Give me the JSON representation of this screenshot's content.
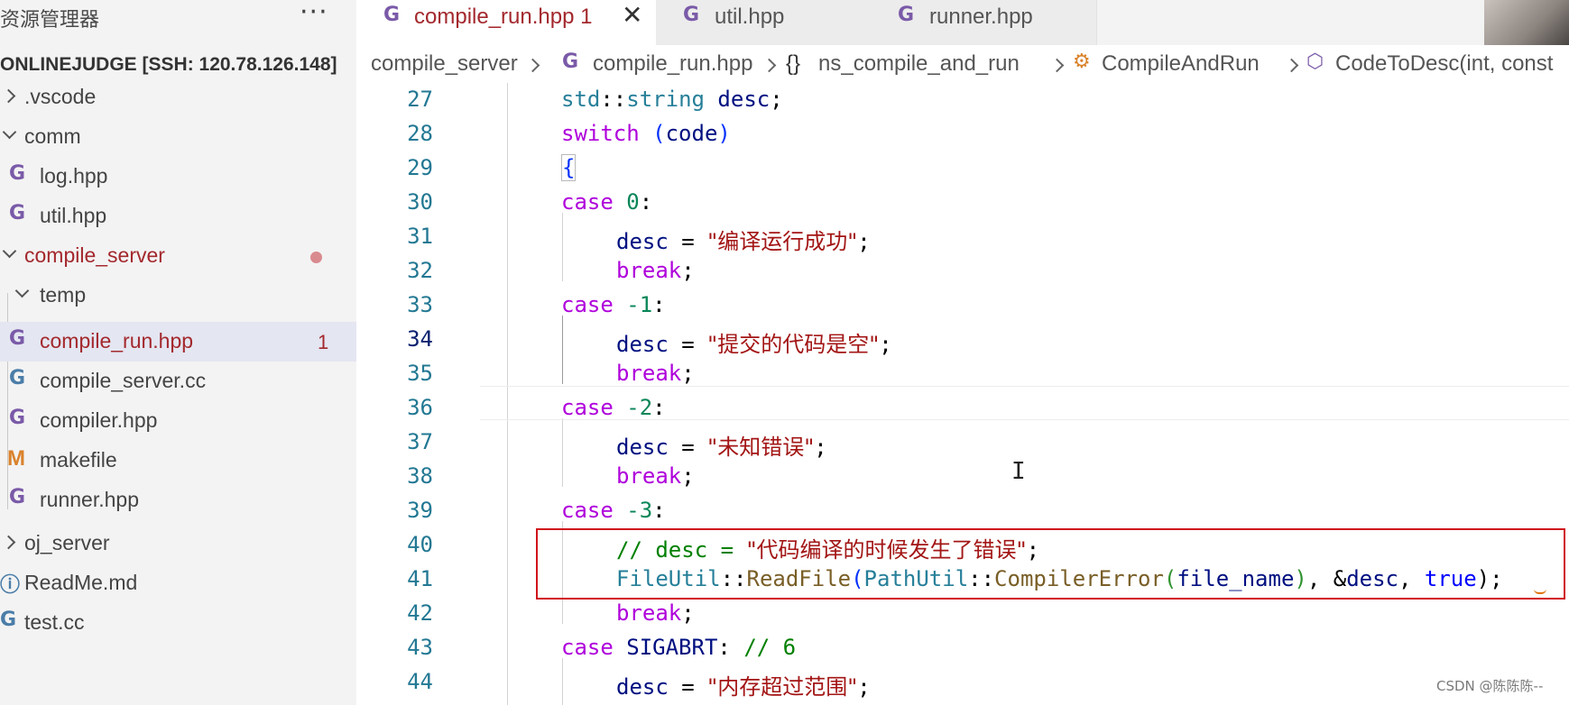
{
  "sidebar": {
    "title": "资源管理器",
    "more": "···",
    "project": "ONLINEJUDGE [SSH: 120.78.126.148]",
    "items": [
      {
        "label": ".vscode",
        "icon": "chevron-right",
        "kind": "folder"
      },
      {
        "label": "comm",
        "icon": "chevron-down",
        "kind": "folder"
      },
      {
        "label": "log.hpp",
        "icon": "cpp-header-icon",
        "kind": "file"
      },
      {
        "label": "util.hpp",
        "icon": "cpp-header-icon",
        "kind": "file"
      },
      {
        "label": "compile_server",
        "icon": "chevron-down",
        "kind": "folder",
        "modified": true
      },
      {
        "label": "temp",
        "icon": "chevron-down",
        "kind": "folder"
      },
      {
        "label": "compile_run.hpp",
        "icon": "cpp-header-icon",
        "kind": "file",
        "badge": "1",
        "selected": true
      },
      {
        "label": "compile_server.cc",
        "icon": "cpp-source-icon",
        "kind": "file"
      },
      {
        "label": "compiler.hpp",
        "icon": "cpp-header-icon",
        "kind": "file"
      },
      {
        "label": "makefile",
        "icon": "makefile-icon",
        "kind": "file"
      },
      {
        "label": "runner.hpp",
        "icon": "cpp-header-icon",
        "kind": "file"
      },
      {
        "label": "oj_server",
        "icon": "chevron-right",
        "kind": "folder"
      },
      {
        "label": "ReadMe.md",
        "icon": "info-icon",
        "kind": "file"
      },
      {
        "label": "test.cc",
        "icon": "cpp-source-icon",
        "kind": "file"
      }
    ]
  },
  "tabs": [
    {
      "label": "compile_run.hpp 1",
      "active": true,
      "close": "✕"
    },
    {
      "label": "util.hpp",
      "active": false
    },
    {
      "label": "runner.hpp",
      "active": false
    }
  ],
  "breadcrumb": {
    "items": [
      "compile_server",
      "compile_run.hpp",
      "ns_compile_and_run",
      "CompileAndRun",
      "CodeToDesc(int, const"
    ],
    "ns_icon": "{}"
  },
  "icons": {
    "cpp": "G",
    "cc": "G",
    "make": "M",
    "info": "ⓘ"
  },
  "editor": {
    "current_line": 34,
    "lines": [
      {
        "n": "27"
      },
      {
        "n": "28"
      },
      {
        "n": "29"
      },
      {
        "n": "30"
      },
      {
        "n": "31"
      },
      {
        "n": "32"
      },
      {
        "n": "33"
      },
      {
        "n": "34"
      },
      {
        "n": "35"
      },
      {
        "n": "36"
      },
      {
        "n": "37"
      },
      {
        "n": "38"
      },
      {
        "n": "39"
      },
      {
        "n": "40"
      },
      {
        "n": "41"
      },
      {
        "n": "42"
      },
      {
        "n": "43"
      },
      {
        "n": "44"
      }
    ],
    "tokens": {
      "std": "std",
      "dcolon": "::",
      "string": "string",
      "desc": "desc",
      "semi": ";",
      "switch": "switch",
      "lparen": "(",
      "code": "code",
      "rparen": ")",
      "lbrace": "{",
      "case": "case",
      "colon": ":",
      "break": "break",
      "eq": "=",
      "n0": "0",
      "n1": "-1",
      "n2": "-2",
      "n3": "-3",
      "s31": "\"编译运行成功\"",
      "s34": "\"提交的代码是空\"",
      "s37": "\"未知错误\"",
      "c40a": "// desc = ",
      "c40b": "\"代码编译的时候发生了错误\"",
      "c40c": ";",
      "FileUtil": "FileUtil",
      "ReadFile": "ReadFile",
      "PathUtil": "PathUtil",
      "CompilerError": "CompilerError",
      "file_name": "file_name",
      "comma_amp": ", &",
      "comma": ", ",
      "true": "true",
      "close2": ");",
      "SIGABRT": "SIGABRT",
      "c43": "// 6",
      "s44": "\"内存超过范围\""
    }
  },
  "watermark": "CSDN @陈陈陈--",
  "colors": {
    "accent_modified": "#a3282d",
    "highlight_box": "#d0101a",
    "line_number": "#237893"
  }
}
